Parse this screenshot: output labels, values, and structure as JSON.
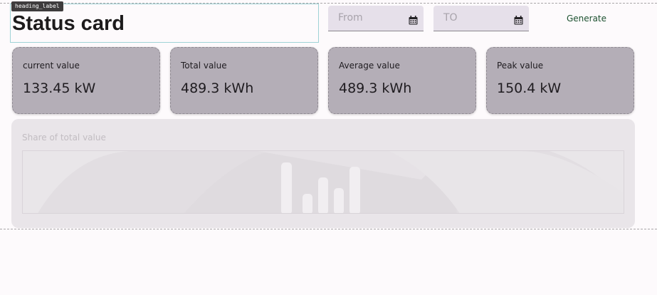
{
  "debug_tag": "heading_label",
  "header": {
    "title": "Status card"
  },
  "date_range": {
    "from_placeholder": "From",
    "to_placeholder": "TO"
  },
  "actions": {
    "generate_label": "Generate"
  },
  "cards": [
    {
      "label": "current value",
      "value": "133.45 kW"
    },
    {
      "label": "Total value",
      "value": "489.3 kWh"
    },
    {
      "label": "Average value",
      "value": "489.3 kWh"
    },
    {
      "label": "Peak value",
      "value": "150.4 kW"
    }
  ],
  "share_panel": {
    "title": "Share of total value",
    "placeholder_icon": "bar-chart-placeholder-icon"
  },
  "icons": {
    "date_picker": "calendar-icon"
  },
  "colors": {
    "card_background": "#b4aeb7",
    "panel_background": "#e9e5e9",
    "generate_text": "#1d5130",
    "field_background": "#e6e0ea"
  }
}
